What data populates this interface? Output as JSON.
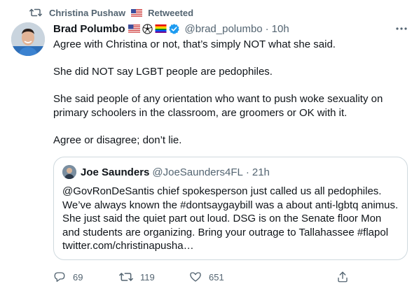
{
  "retweet_context": {
    "label": "Christina Pushaw",
    "suffix": "Retweeted",
    "icon": "retweet-icon",
    "flag_icon": "us-flag-icon"
  },
  "tweet": {
    "author_name": "Brad Polumbo",
    "badges": [
      "us-flag-icon",
      "soccer-ball-icon",
      "rainbow-flag-icon",
      "verified-badge-icon"
    ],
    "handle": "@brad_polumbo",
    "separator": "·",
    "time": "10h",
    "more_icon": "more-dots-icon",
    "paragraphs": [
      "Agree with Christina or not, that’s simply NOT what she said.",
      "She did NOT say LGBT people are pedophiles.",
      "She said people of any orientation who want to push woke sexuality on primary schoolers in the classroom, are groomers or OK with it.",
      "Agree or disagree; don’t lie."
    ]
  },
  "quoted_tweet": {
    "author_name": "Joe Saunders",
    "handle": "@JoeSaunders4FL",
    "separator": "·",
    "time": "21h",
    "text": "@GovRonDeSantis chief spokesperson just called us all pedophiles. We’ve always known the #dontsaygaybill was a about anti-lgbtq animus. She just said the quiet part out loud. DSG is on the Senate floor Mon and students are organizing. Bring your outrage to Tallahassee #flapol twitter.com/christinapusha…"
  },
  "actions": {
    "reply_count": "69",
    "retweet_count": "119",
    "like_count": "651",
    "share_icon": "share-icon"
  },
  "colors": {
    "text_primary": "#0f1419",
    "text_secondary": "#536471",
    "border": "#cfd9de",
    "verified": "#1d9bf0"
  }
}
